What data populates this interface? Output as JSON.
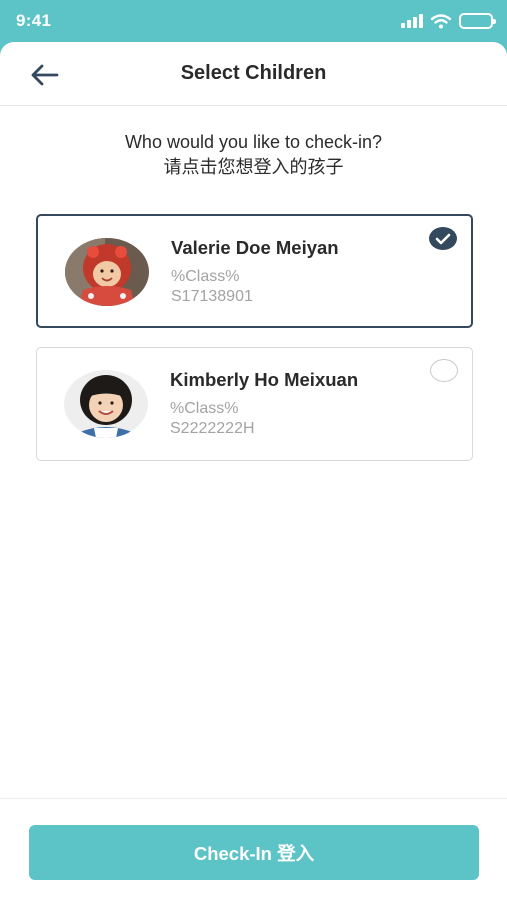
{
  "status_bar": {
    "time": "9:41"
  },
  "header": {
    "title": "Select Children"
  },
  "prompt": {
    "english": "Who would you like to check-in?",
    "chinese": "请点击您想登入的孩子"
  },
  "children": [
    {
      "name": "Valerie Doe Meiyan",
      "class": "%Class%",
      "id": "S17138901",
      "selected": true
    },
    {
      "name": "Kimberly Ho Meixuan",
      "class": "%Class%",
      "id": "S2222222H",
      "selected": false
    }
  ],
  "footer": {
    "checkin_label": "Check-In  登入"
  },
  "colors": {
    "accent": "#5cc3c6",
    "selected": "#34495e",
    "muted_text": "#a3a3a3"
  }
}
